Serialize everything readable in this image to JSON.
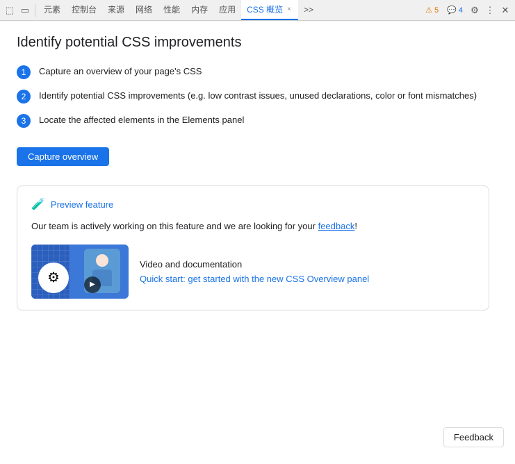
{
  "toolbar": {
    "icons": [
      {
        "name": "inspect-icon",
        "glyph": "⬚"
      },
      {
        "name": "device-icon",
        "glyph": "▭"
      }
    ],
    "tabs": [
      {
        "id": "elements",
        "label": "元素",
        "active": false
      },
      {
        "id": "console",
        "label": "控制台",
        "active": false
      },
      {
        "id": "sources",
        "label": "来源",
        "active": false
      },
      {
        "id": "network",
        "label": "网络",
        "active": false
      },
      {
        "id": "performance",
        "label": "性能",
        "active": false
      },
      {
        "id": "memory",
        "label": "内存",
        "active": false
      },
      {
        "id": "application",
        "label": "应用",
        "active": false
      },
      {
        "id": "css-overview",
        "label": "CSS 概览",
        "active": true,
        "closeable": true
      }
    ],
    "more_tabs": ">>",
    "warning_count": "5",
    "warning_icon": "⚠",
    "message_count": "4",
    "message_icon": "💬",
    "settings_icon": "⚙",
    "more_icon": "⋮",
    "close_icon": "✕"
  },
  "page": {
    "title": "Identify potential CSS improvements",
    "steps": [
      {
        "number": "1",
        "text": "Capture an overview of your page's CSS"
      },
      {
        "number": "2",
        "text": "Identify potential CSS improvements (e.g. low contrast issues, unused declarations, color or font mismatches)"
      },
      {
        "number": "3",
        "text": "Locate the affected elements in the Elements panel"
      }
    ],
    "capture_button": "Capture overview",
    "preview_card": {
      "icon": "🧪",
      "label": "Preview feature",
      "description_before": "Our team is actively working on this feature and we are looking for your ",
      "feedback_link_text": "feedback",
      "description_after": "!",
      "video_section": {
        "label": "Video and documentation",
        "link_text": "Quick start: get started with the new CSS Overview panel",
        "link_url": "#"
      }
    },
    "feedback_button": "Feedback"
  }
}
